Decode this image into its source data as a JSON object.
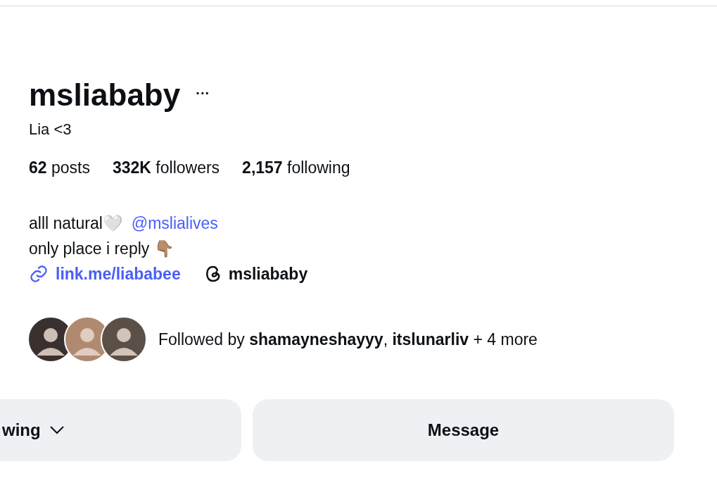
{
  "profile": {
    "username": "msliababy",
    "more_button": "···",
    "display_name": "Lia <3"
  },
  "stats": [
    {
      "number": "62",
      "label": "posts"
    },
    {
      "number": "332K",
      "label": "followers"
    },
    {
      "number": "2,157",
      "label": "following"
    }
  ],
  "bio": {
    "lines": [
      {
        "text": "alll natural🤍",
        "mention": "@mslialives"
      },
      {
        "text": "only place i reply 👇🏽"
      }
    ],
    "link": "link.me/liababee",
    "threads": "msliababy"
  },
  "followed_by": {
    "avatars": [
      {
        "color": "#3b3030"
      },
      {
        "color": "#b08a70"
      },
      {
        "color": "#5a5048"
      }
    ],
    "text": "Followed by **shamayneshayyy**, **itslunarliv** + 4 more"
  },
  "buttons": [
    {
      "kind": "dropdown",
      "label": "wing"
    },
    {
      "kind": "plain",
      "label": "Message"
    }
  ]
}
